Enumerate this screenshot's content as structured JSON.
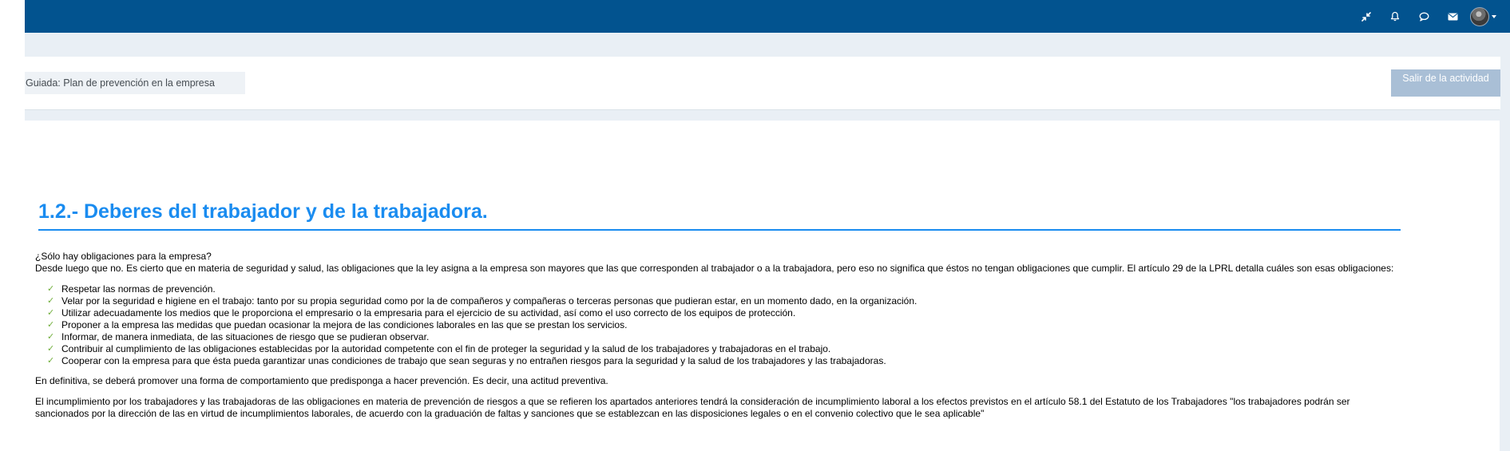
{
  "header": {
    "icons": [
      "compress-icon",
      "bell-icon",
      "chat-icon",
      "envelope-icon"
    ],
    "user_menu": "avatar"
  },
  "activity": {
    "title": "Guiada: Plan de prevención en la empresa",
    "exit_label": "Salir de la actividad"
  },
  "section": {
    "heading": "1.2.- Deberes del trabajador y de la trabajadora.",
    "question": "¿Sólo hay obligaciones para la empresa?",
    "intro": "Desde luego que no. Es cierto que en materia de seguridad y salud, las obligaciones que la ley asigna a la empresa son mayores que las que corresponden al trabajador o a la trabajadora, pero eso no significa que éstos no tengan obligaciones que cumplir. El artículo 29 de la LPRL detalla cuáles son esas obligaciones:",
    "duties": [
      "Respetar las normas de prevención.",
      "Velar por la seguridad e higiene en el trabajo: tanto por su propia seguridad como por la de compañeros y compañeras o terceras personas que pudieran estar, en un momento dado, en la organización.",
      "Utilizar adecuadamente los medios que le proporciona el empresario o la empresaria para el ejercicio de su actividad, así como el uso correcto de los equipos de protección.",
      "Proponer a la empresa las medidas que puedan ocasionar la mejora de las condiciones laborales en las que se prestan los servicios.",
      "Informar, de manera inmediata, de las situaciones de riesgo que se pudieran observar.",
      "Contribuir al cumplimiento de las obligaciones establecidas por la autoridad competente con el fin de proteger la seguridad y la salud de los trabajadores y trabajadoras en el trabajo.",
      "Cooperar con la empresa para que ésta pueda garantizar unas condiciones de trabajo que sean seguras y no entrañen riesgos para la seguridad y la salud de los trabajadores y las trabajadoras."
    ],
    "conclusion": "En definitiva, se deberá promover una forma de comportamiento que predisponga a hacer prevención. Es decir, una actitud preventiva.",
    "sanctions": "El incumplimiento por los trabajadores y las trabajadoras de las obligaciones en materia de prevención de riesgos a que se refieren los apartados anteriores tendrá la consideración de incumplimiento laboral a los efectos previstos en el artículo 58.1 del Estatuto de los Trabajadores \"los trabajadores podrán ser sancionados por la dirección de las en virtud de incumplimientos laborales, de acuerdo con la graduación de faltas y sanciones que se establezcan en las disposiciones legales o en el convenio colectivo que le sea aplicable\""
  },
  "colors": {
    "navbar": "#02538f",
    "heading": "#1a8cf0",
    "check": "#6fae3a",
    "exit_button": "#a9bfd6"
  }
}
